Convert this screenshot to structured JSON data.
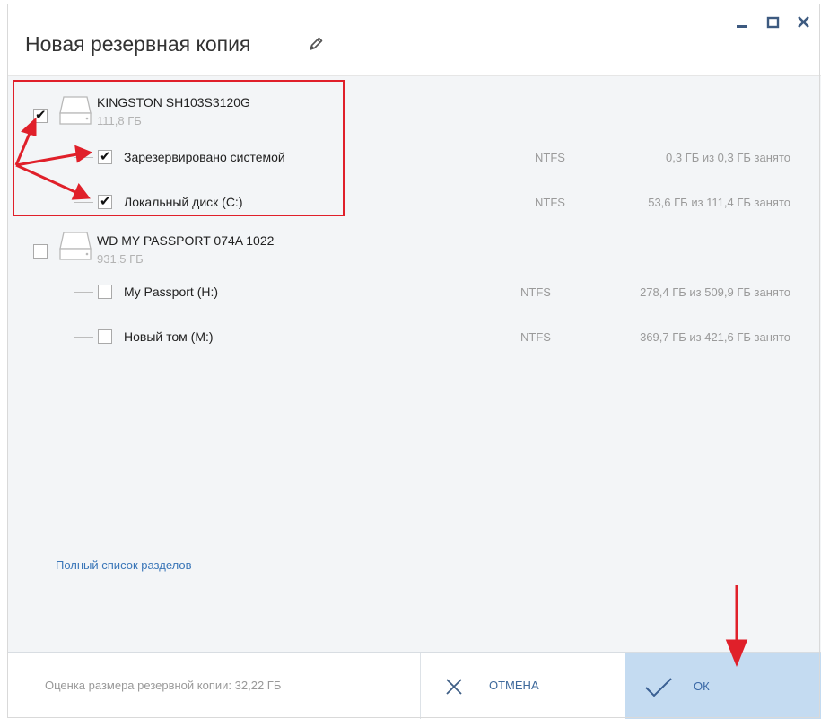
{
  "window": {
    "title": "Новая резервная копия"
  },
  "disks": [
    {
      "name": "KINGSTON SH103S3120G",
      "size": "111,8 ГБ",
      "checked": true,
      "partitions": [
        {
          "name": "Зарезервировано системой",
          "fs": "NTFS",
          "usage": "0,3 ГБ из 0,3 ГБ занято",
          "checked": true
        },
        {
          "name": "Локальный диск (C:)",
          "fs": "NTFS",
          "usage": "53,6 ГБ из 111,4 ГБ занято",
          "checked": true
        }
      ]
    },
    {
      "name": "WD MY PASSPORT 074A 1022",
      "size": "931,5 ГБ",
      "checked": false,
      "partitions": [
        {
          "name": "My Passport (H:)",
          "fs": "NTFS",
          "usage": "278,4 ГБ из 509,9 ГБ занято",
          "checked": false
        },
        {
          "name": "Новый том (M:)",
          "fs": "NTFS",
          "usage": "369,7 ГБ из 421,6 ГБ занято",
          "checked": false
        }
      ]
    }
  ],
  "full_list_link": "Полный список разделов",
  "footer": {
    "estimate": "Оценка размера резервной копии: 32,22 ГБ",
    "cancel_label": "ОТМЕНА",
    "ok_label": "ОК"
  },
  "colors": {
    "accent": "#3a76b8",
    "ok_button_bg": "#c4dbf1",
    "annotation_red": "#e0202a"
  },
  "icons": [
    "pencil-icon",
    "minimize-icon",
    "maximize-icon",
    "close-icon",
    "hard-drive-icon",
    "cancel-x-icon",
    "ok-check-icon"
  ]
}
